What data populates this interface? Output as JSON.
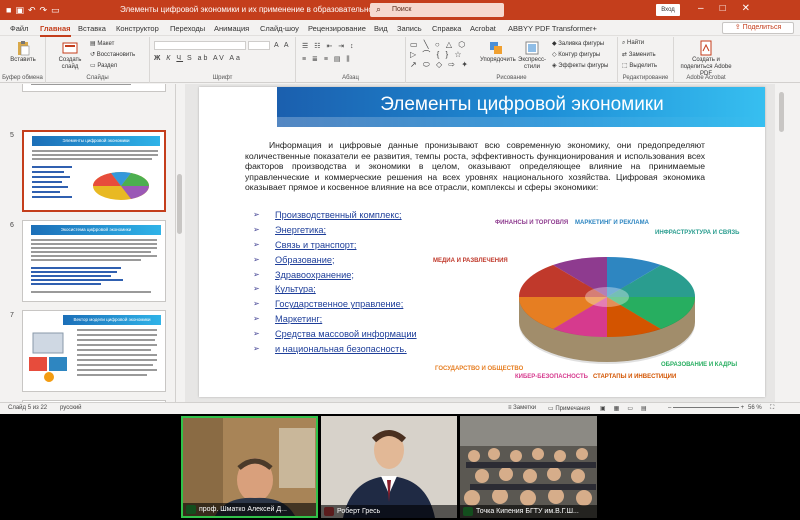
{
  "window": {
    "doc_title": "Элементы цифровой экономики и их применение в образовательном процессе - PowerPoint",
    "search_label": "Поиск",
    "login_label": "Вход"
  },
  "menu": {
    "tabs": [
      "Файл",
      "Главная",
      "Вставка",
      "Конструктор",
      "Переходы",
      "Анимация",
      "Слайд-шоу",
      "Рецензирование",
      "Вид",
      "Запись",
      "Справка",
      "Acrobat",
      "ABBYY PDF Transformer+"
    ],
    "active_tab": "Главная",
    "share_label": "Поделиться"
  },
  "ribbon": {
    "paste_label": "Вставить",
    "create_slide_label": "Создать слайд",
    "layout_label": "Макет",
    "reset_label": "Восстановить",
    "section_label": "Раздел",
    "drawing_label": "Рисование",
    "arrange_label": "Упорядочить",
    "quick_styles_label": "Экспресс-стили",
    "fill_label": "Заливка фигуры",
    "outline_label": "Контур фигуры",
    "effects_label": "Эффекты фигуры",
    "find_label": "Найти",
    "replace_label": "Заменить",
    "select_label": "Выделить",
    "adobe_label": "Создать и поделиться Adobe PDF",
    "groups": {
      "clipboard": "Буфер обмена",
      "slides": "Слайды",
      "font": "Шрифт",
      "paragraph": "Абзац",
      "drawing": "Рисование",
      "editing": "Редактирование",
      "acrobat": "Adobe Acrobat"
    }
  },
  "thumbnails": [
    {
      "num": "5",
      "title": "Элементы цифровой экономики",
      "selected": true
    },
    {
      "num": "6",
      "title": "Экосистема цифровой экономики",
      "selected": false
    },
    {
      "num": "7",
      "title": "Вектор модели цифровой экономики",
      "selected": false
    }
  ],
  "slide": {
    "title": "Элементы цифровой экономики",
    "paragraph": "Информация и цифровые данные пронизывают всю современную экономику, они предопределяют количественные показатели ее развития, темпы роста, эффективность функционирования и использования всех факторов производства и экономики в целом, оказывают определяющее влияние на принимаемые управленческие и коммерческие решения на всех уровнях национального хозяйства. Цифровая экономика оказывает прямое и косвенное влияние на все отрасли, комплексы и сферы экономики:",
    "bullets": [
      "Производственный комплекс;",
      "Энергетика;",
      "Связь и транспорт;",
      "Образование;",
      "Здравоохранение;",
      "Культура;",
      "Государственное управление;",
      "Маркетинг;",
      "Средства массовой информации",
      "и национальная безопасность."
    ],
    "infographic": [
      {
        "label": "ФИНАНСЫ И ТОРГОВЛЯ",
        "color": "#8e3b8f"
      },
      {
        "label": "МАРКЕТИНГ И РЕКЛАМА",
        "color": "#2e86c1"
      },
      {
        "label": "ИНФРАСТРУКТУРА И СВЯЗЬ",
        "color": "#2a9d8f"
      },
      {
        "label": "МЕДИА И РАЗВЛЕЧЕНИЯ",
        "color": "#c0392b"
      },
      {
        "label": "ГОСУДАРСТВО И ОБЩЕСТВО",
        "color": "#e67e22"
      },
      {
        "label": "КИБЕР-БЕЗОПАСНОСТЬ",
        "color": "#d63a8e"
      },
      {
        "label": "СТАРТАПЫ И ИНВЕСТИЦИИ",
        "color": "#d35400"
      },
      {
        "label": "ОБРАЗОВАНИЕ И КАДРЫ",
        "color": "#27ae60"
      }
    ]
  },
  "status": {
    "slide_info": "Слайд 5 из 22",
    "language": "русский",
    "notes_label": "Заметки",
    "comments_label": "Примечания",
    "zoom": "56 %"
  },
  "participants": [
    {
      "name": "проф. Шматко Алексей Д...",
      "mic": "on"
    },
    {
      "name": "Роберт Гресь",
      "mic": "off"
    },
    {
      "name": "Точка Кипения БГТУ им.В.Г.Ш...",
      "mic": "on"
    }
  ]
}
